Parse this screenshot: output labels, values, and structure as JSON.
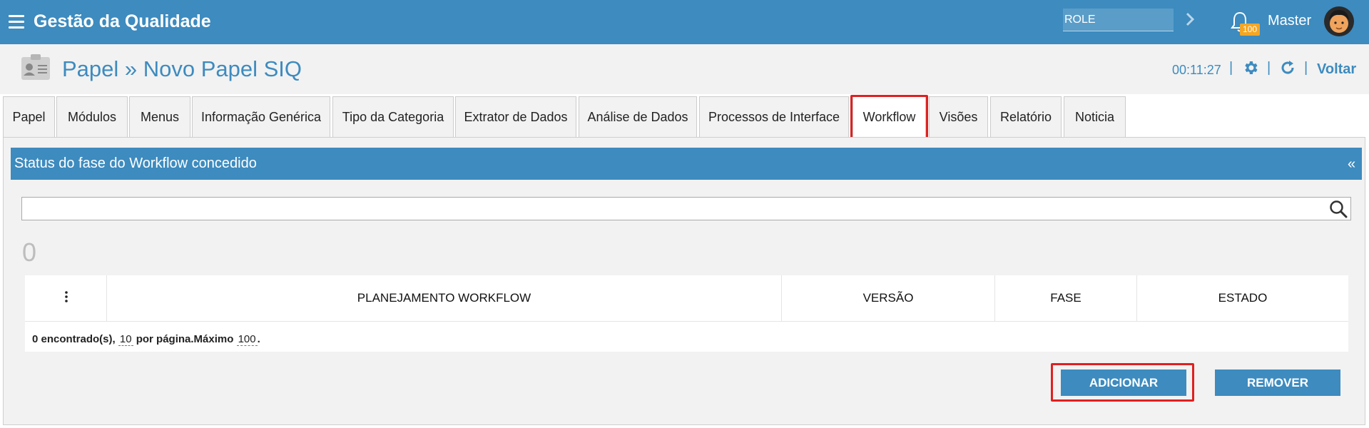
{
  "topbar": {
    "title": "Gestão da Qualidade",
    "role_value": "ROLE",
    "notification_count": "100",
    "user_name": "Master"
  },
  "header": {
    "title": "Papel » Novo Papel SIQ",
    "timer": "00:11:27",
    "separator": "|",
    "back_label": "Voltar"
  },
  "tabs": [
    {
      "label": "Papel"
    },
    {
      "label": "Módulos"
    },
    {
      "label": "Menus"
    },
    {
      "label": "Informação Genérica"
    },
    {
      "label": "Tipo da Categoria"
    },
    {
      "label": "Extrator de Dados"
    },
    {
      "label": "Análise de Dados"
    },
    {
      "label": "Processos de Interface"
    },
    {
      "label": "Workflow"
    },
    {
      "label": "Visões"
    },
    {
      "label": "Relatório"
    },
    {
      "label": "Noticia"
    }
  ],
  "section": {
    "title": "Status do fase do Workflow concedido",
    "collapse_glyph": "«",
    "search_value": "",
    "count": "0"
  },
  "table": {
    "columns": [
      "PLANEJAMENTO WORKFLOW",
      "VERSÃO",
      "FASE",
      "ESTADO"
    ],
    "rows": [],
    "footer": {
      "prefix": "0 encontrado(s),",
      "per_page": "10",
      "middle": "por página.Máximo",
      "max": "100",
      "suffix": "."
    }
  },
  "buttons": {
    "add": "ADICIONAR",
    "remove": "REMOVER"
  },
  "colors": {
    "primary": "#3d8bbf",
    "badge": "#f5a623",
    "highlight": "#e02020"
  }
}
